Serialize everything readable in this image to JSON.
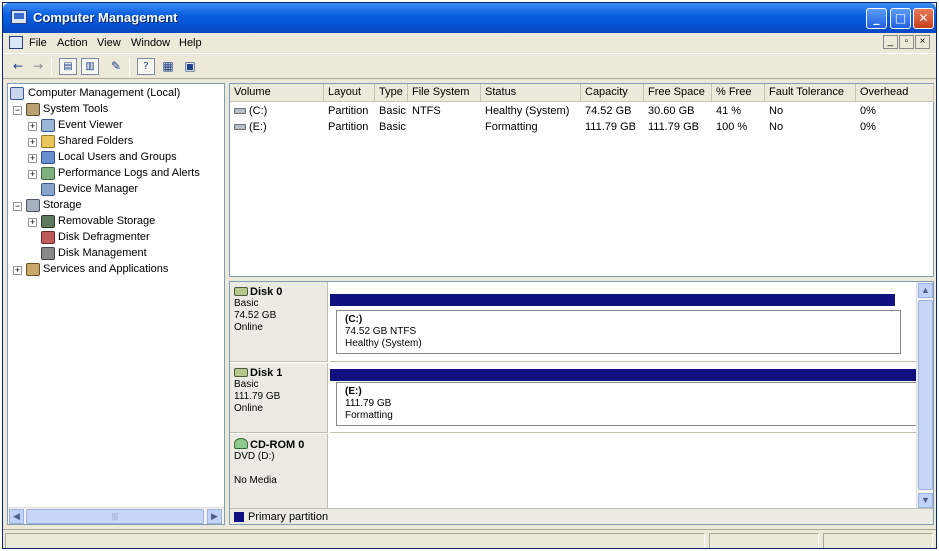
{
  "window": {
    "title": "Computer Management"
  },
  "menu": {
    "items": [
      "File",
      "Action",
      "View",
      "Window",
      "Help"
    ]
  },
  "tree": {
    "items": [
      {
        "label": "Computer Management (Local)",
        "icon": "computer-icon"
      },
      {
        "label": "System Tools",
        "icon": "tools-icon"
      },
      {
        "label": "Event Viewer",
        "icon": "event-viewer-icon"
      },
      {
        "label": "Shared Folders",
        "icon": "folder-icon"
      },
      {
        "label": "Local Users and Groups",
        "icon": "users-icon"
      },
      {
        "label": "Performance Logs and Alerts",
        "icon": "performance-icon"
      },
      {
        "label": "Device Manager",
        "icon": "device-manager-icon"
      },
      {
        "label": "Storage",
        "icon": "storage-icon"
      },
      {
        "label": "Removable Storage",
        "icon": "removable-storage-icon"
      },
      {
        "label": "Disk Defragmenter",
        "icon": "defrag-icon"
      },
      {
        "label": "Disk Management",
        "icon": "disk-management-icon"
      },
      {
        "label": "Services and Applications",
        "icon": "services-icon"
      }
    ]
  },
  "volumes": {
    "columns": [
      "Volume",
      "Layout",
      "Type",
      "File System",
      "Status",
      "Capacity",
      "Free Space",
      "% Free",
      "Fault Tolerance",
      "Overhead"
    ],
    "rows": [
      [
        "(C:)",
        "Partition",
        "Basic",
        "NTFS",
        "Healthy (System)",
        "74.52 GB",
        "30.60 GB",
        "41 %",
        "No",
        "0%"
      ],
      [
        "(E:)",
        "Partition",
        "Basic",
        "",
        "Formatting",
        "111.79 GB",
        "111.79 GB",
        "100 %",
        "No",
        "0%"
      ]
    ]
  },
  "disks": {
    "disk0": {
      "name": "Disk 0",
      "type": "Basic",
      "size": "74.52 GB",
      "status": "Online",
      "partition": {
        "name": "(C:)",
        "detail": "74.52 GB NTFS",
        "status": "Healthy (System)"
      }
    },
    "disk1": {
      "name": "Disk 1",
      "type": "Basic",
      "size": "111.79 GB",
      "status": "Online",
      "partition": {
        "name": "(E:)",
        "detail": "111.79 GB",
        "status": "Formatting"
      }
    },
    "cdrom0": {
      "name": "CD-ROM 0",
      "type": "DVD (D:)",
      "status": "No Media"
    }
  },
  "legend": {
    "label": "Primary partition",
    "color": "#101080"
  }
}
